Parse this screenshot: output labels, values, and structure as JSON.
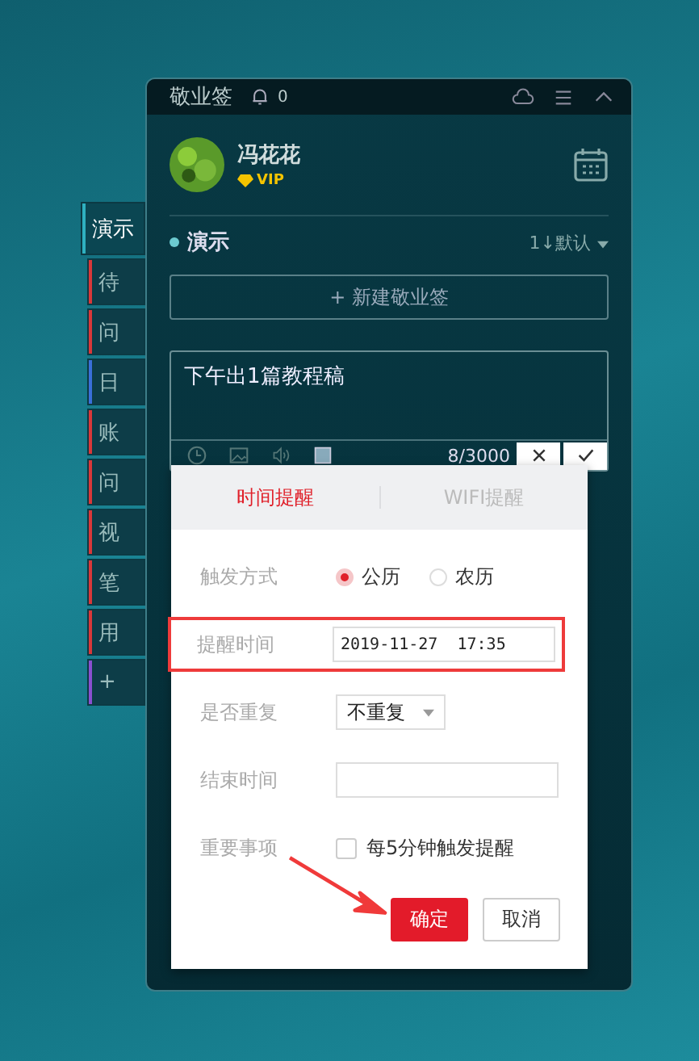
{
  "window": {
    "title": "敬业签",
    "notification_count": "0"
  },
  "user": {
    "name": "冯花花",
    "badge": "VIP"
  },
  "side_tabs": [
    {
      "label": "演示",
      "selected": true,
      "color": "#2fb0c0"
    },
    {
      "label": "待",
      "selected": false,
      "color": "#d9383a"
    },
    {
      "label": "问",
      "selected": false,
      "color": "#d9383a"
    },
    {
      "label": "日",
      "selected": false,
      "color": "#3a6fd9"
    },
    {
      "label": "账",
      "selected": false,
      "color": "#d9383a"
    },
    {
      "label": "问",
      "selected": false,
      "color": "#d9383a"
    },
    {
      "label": "视",
      "selected": false,
      "color": "#d9383a"
    },
    {
      "label": "笔",
      "selected": false,
      "color": "#d9383a"
    },
    {
      "label": "用",
      "selected": false,
      "color": "#d9383a"
    },
    {
      "label": "+",
      "selected": false,
      "color": "#8a4fd0"
    }
  ],
  "category": {
    "name": "演示",
    "sort": "1↓默认"
  },
  "new_note_button": "+ 新建敬业签",
  "editor": {
    "value": "下午出1篇教程稿",
    "count": "8/3000"
  },
  "reminder": {
    "tabs": [
      {
        "label": "时间提醒",
        "selected": true
      },
      {
        "label": "WIFI提醒",
        "selected": false
      }
    ],
    "fields": [
      {
        "kind": "radio",
        "label": "触发方式",
        "options": [
          {
            "label": "公历",
            "selected": true
          },
          {
            "label": "农历",
            "selected": false
          }
        ]
      },
      {
        "kind": "input",
        "label": "提醒时间",
        "value": "2019-11-27  17:35",
        "highlighted": true
      },
      {
        "kind": "select",
        "label": "是否重复",
        "value": "不重复"
      },
      {
        "kind": "input",
        "label": "结束时间",
        "highlighted": false
      },
      {
        "kind": "checkbox",
        "label": "重要事项",
        "option": "每5分钟触发提醒",
        "checked": false
      }
    ],
    "buttons": [
      {
        "label": "确定",
        "kind": "primary"
      },
      {
        "label": "取消",
        "kind": "secondary"
      }
    ]
  }
}
